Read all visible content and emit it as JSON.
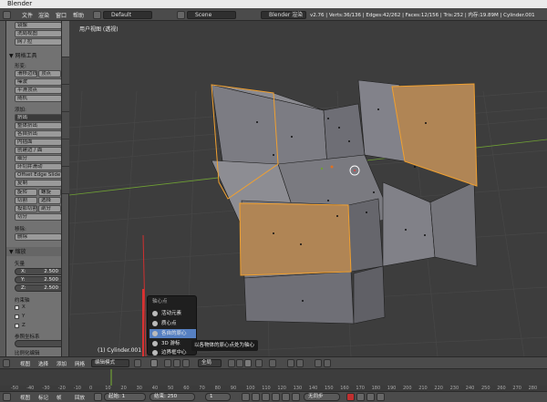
{
  "title": "Blender",
  "top_menu": [
    "文件",
    "渲染",
    "窗口",
    "帮助"
  ],
  "layout_field": "Default",
  "scene_field": "Scene",
  "render_engine": "Blender 渲染",
  "stats": "v2.76 | Verts:36/136 | Edges:42/262 | Faces:12/156 | Tris:252 | 内存:19.89M | Cylinder.001",
  "tool_panel": {
    "top_buttons": [
      "镜像",
      "洗局视图",
      "网 / 拉"
    ],
    "mesh_tools_header": "▼ 网格工具",
    "deform_label": "形变:",
    "deform_buttons": [
      [
        "滑移边线",
        "顶点"
      ],
      [
        "噪波"
      ],
      [
        "平滑顶点"
      ],
      [
        "随机"
      ]
    ],
    "add_label": "添加:",
    "add_buttons": [
      "挤出",
      "整体挤出",
      "各自挤出",
      "内插面",
      "创建边 / 面",
      "细分",
      "环切并滑动",
      "Offset Edge Slide",
      "复制"
    ],
    "pair1": [
      "旋转",
      "螺旋"
    ],
    "pair2": [
      "切割",
      "选择"
    ],
    "pair3": [
      "投影切割",
      "剖分"
    ],
    "bisect": "切分",
    "remove_label": "移除:",
    "remove_button": "删除",
    "scale_header": "▼ 缩放",
    "vector_label": "矢量",
    "x_label": "X:",
    "x_value": "2.500",
    "y_label": "Y:",
    "y_value": "2.500",
    "z_label": "Z:",
    "z_value": "2.500",
    "constraint_label": "约束轴",
    "axis_x": "X",
    "axis_y": "Y",
    "axis_z": "Z",
    "orientation_label": "参照坐标系",
    "proportional_label": "比例化编辑"
  },
  "viewport": {
    "title": "用户视图 (透视)",
    "object_name": "(1) Cylinder.001"
  },
  "pivot_popup": {
    "header": "轴心点",
    "items": [
      "活动元素",
      "质心点",
      "各自的原心",
      "3D 游标",
      "边界框中心"
    ],
    "selected_index": 2
  },
  "tooltip": "以各物体的原心点处为轴心",
  "viewport_header": {
    "menus": [
      "视图",
      "选择",
      "添加",
      "网格"
    ],
    "mode": "编辑模式",
    "orientation": "全局"
  },
  "timeline_ruler": [
    "-50",
    "-40",
    "-30",
    "-20",
    "-10",
    "0",
    "10",
    "20",
    "30",
    "40",
    "50",
    "60",
    "70",
    "80",
    "90",
    "100",
    "110",
    "120",
    "130",
    "140",
    "150",
    "160",
    "170",
    "180",
    "190",
    "200",
    "210",
    "220",
    "230",
    "240",
    "250",
    "260",
    "270",
    "280"
  ],
  "bottom_bar": {
    "menus": [
      "视图",
      "标记",
      "帧",
      "回放"
    ],
    "start_label": "起始:",
    "start_value": "1",
    "end_label": "结束:",
    "end_value": "250",
    "current_frame": "1",
    "sync_mode": "无同步"
  },
  "colors": {
    "selected_face": "#b08555",
    "selection_outline": "#f0a030",
    "popup_highlight": "#5680c2",
    "x_axis": "#d03030",
    "y_axis": "#6fa034"
  }
}
